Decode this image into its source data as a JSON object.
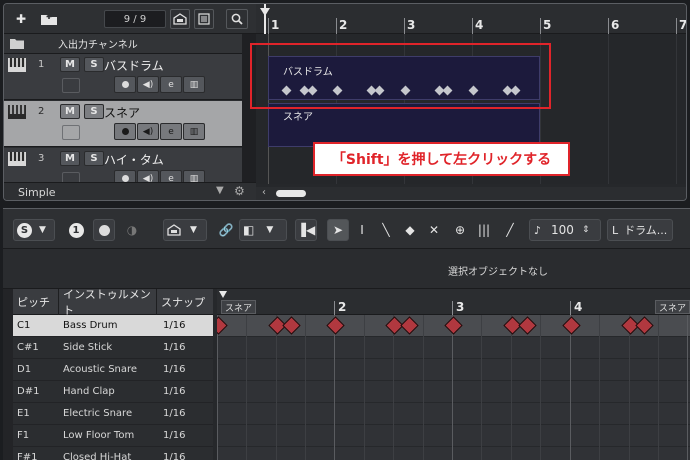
{
  "project": {
    "track_counter": "9 / 9",
    "folder_track": "入出力チャンネル",
    "mute_label": "M",
    "solo_label": "S",
    "edit_label": "e",
    "tracks": [
      {
        "number": "1",
        "name": "バスドラム"
      },
      {
        "number": "2",
        "name": "スネア"
      },
      {
        "number": "3",
        "name": "ハイ・タム"
      }
    ],
    "preset": "Simple",
    "ruler_marks": [
      "1",
      "2",
      "3",
      "4",
      "5",
      "6",
      "7"
    ],
    "parts": [
      "バスドラム",
      "スネア"
    ],
    "callout": "「Shift」を押して左クリックする"
  },
  "drum_editor": {
    "mode_badge_1": "S",
    "mode_badge_2": "1",
    "velocity": "100",
    "drum_map": "ドラム...",
    "info": "選択オブジェクトなし",
    "columns": [
      "ピッチ",
      "インストゥルメント",
      "スナップ"
    ],
    "rows": [
      {
        "pitch": "C1",
        "instrument": "Bass Drum",
        "snap": "1/16"
      },
      {
        "pitch": "C#1",
        "instrument": "Side Stick",
        "snap": "1/16"
      },
      {
        "pitch": "D1",
        "instrument": "Acoustic Snare",
        "snap": "1/16"
      },
      {
        "pitch": "D#1",
        "instrument": "Hand Clap",
        "snap": "1/16"
      },
      {
        "pitch": "E1",
        "instrument": "Electric Snare",
        "snap": "1/16"
      },
      {
        "pitch": "F1",
        "instrument": "Low Floor Tom",
        "snap": "1/16"
      },
      {
        "pitch": "F#1",
        "instrument": "Closed Hi-Hat",
        "snap": "1/16"
      }
    ],
    "ruler_marks": [
      "2",
      "3",
      "4"
    ],
    "part_tag_left": "スネア",
    "part_tag_right": "スネア"
  },
  "colors": {
    "accent_red": "#e0242a",
    "note_red": "#b1383f",
    "part_bg": "#1c1a3c"
  },
  "icons": [
    "add-track-icon",
    "add-folder-icon",
    "instrument-icon",
    "list-icon",
    "search-icon",
    "gear-icon",
    "solo-icon",
    "record-icon",
    "speaker-icon",
    "piano-icon",
    "link-icon",
    "pointer-icon",
    "range-icon",
    "draw-icon",
    "eraser-icon",
    "mute-tool-icon",
    "zoom-icon",
    "drumstick-icon",
    "line-tool-icon"
  ]
}
